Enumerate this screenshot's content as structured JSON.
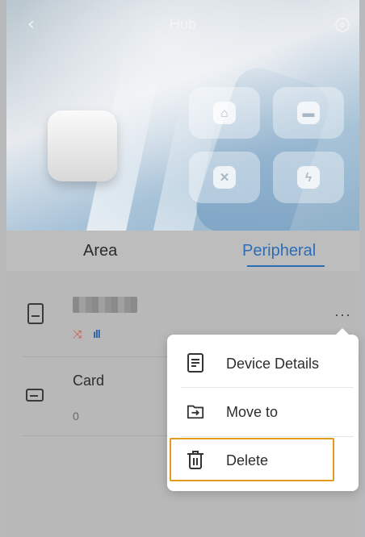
{
  "header": {
    "title": "Hub",
    "back_icon": "chevron-left-icon",
    "settings_icon": "settings-icon"
  },
  "tabs": [
    {
      "label": "Area"
    },
    {
      "label": "Peripheral"
    }
  ],
  "devices": [
    {
      "name": "",
      "icons": [
        "shuffle-icon",
        "signal-icon"
      ]
    },
    {
      "name": "Card",
      "count": "0"
    }
  ],
  "menu": {
    "items": [
      {
        "label": "Device Details",
        "icon": "document-icon"
      },
      {
        "label": "Move to",
        "icon": "folder-move-icon"
      },
      {
        "label": "Delete",
        "icon": "trash-icon"
      }
    ]
  },
  "colors": {
    "accent": "#2c6db6",
    "highlight": "#e09a1e",
    "signal": "#2e63a8",
    "shuffle": "#c85a49"
  }
}
